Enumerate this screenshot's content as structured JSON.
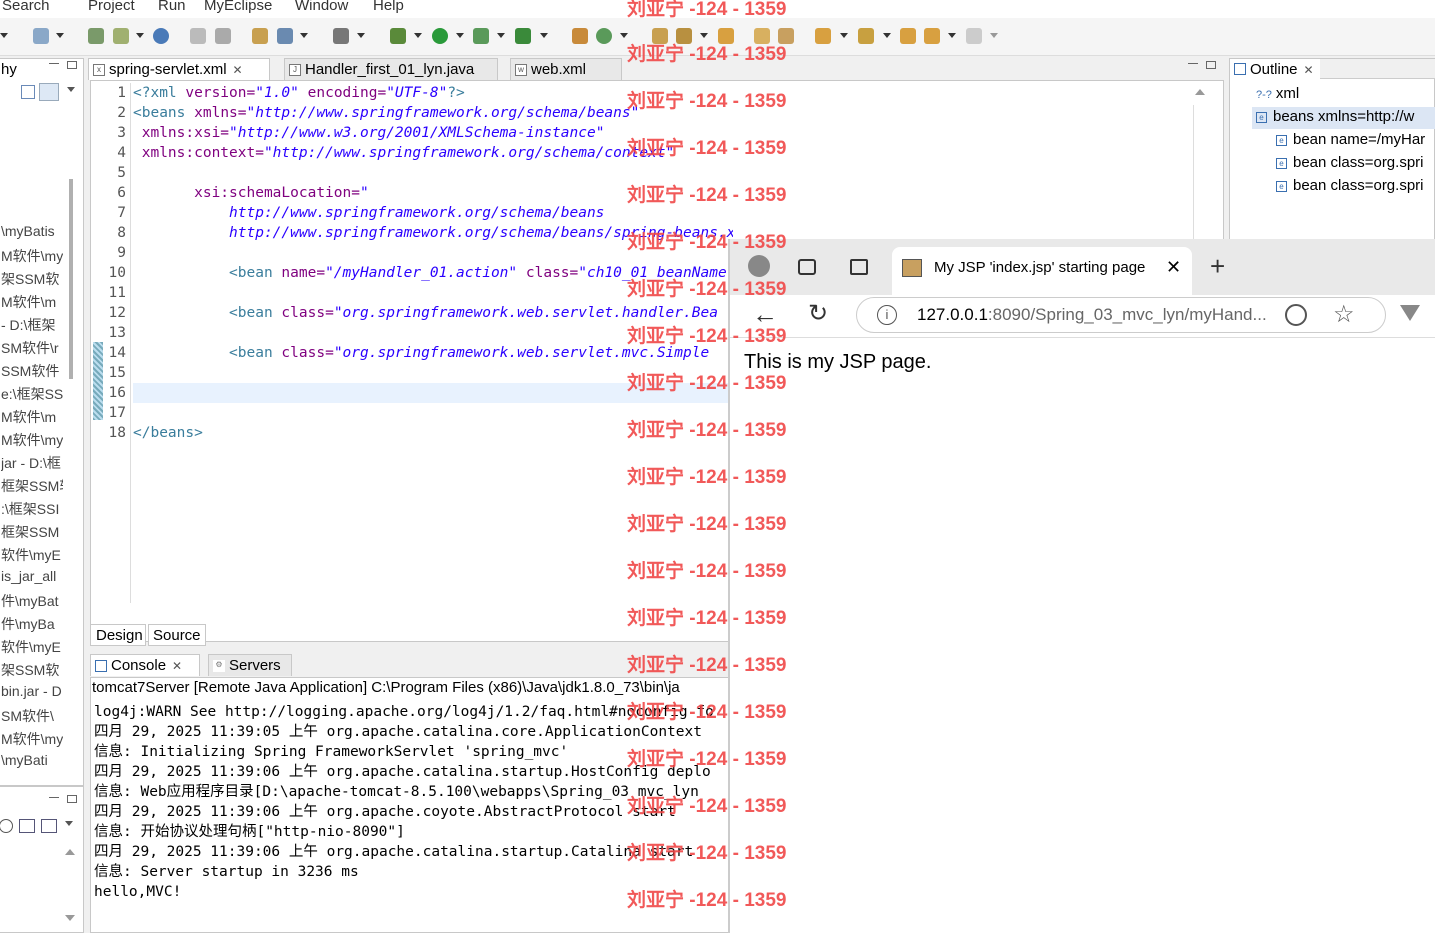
{
  "menu": [
    "Search",
    "Project",
    "Run",
    "MyEclipse",
    "Window",
    "Help"
  ],
  "left_panel": {
    "tab_label": "hy",
    "items": [
      "\\myBatis",
      "M软件\\my",
      "架SSM软",
      "M软件\\m",
      " - D:\\框架",
      "SM软件\\r",
      "SSM软件",
      "e:\\框架SS",
      "M软件\\m",
      "M软件\\my",
      "jar - D:\\框",
      "框架SSM软",
      ":\\框架SSI",
      "框架SSM",
      "软件\\myE",
      "is_jar_all",
      "件\\myBat",
      "件\\myBa",
      "软件\\myE",
      "架SSM软",
      "bin.jar - D",
      "SM软件\\",
      "M软件\\my",
      "\\myBati"
    ]
  },
  "editor": {
    "tabs": [
      {
        "label": "spring-servlet.xml",
        "icon": "xml-file-icon",
        "active": true
      },
      {
        "label": "Handler_first_01_lyn.java",
        "icon": "java-file-icon",
        "active": false
      },
      {
        "label": "web.xml",
        "icon": "web-xml-icon",
        "active": false
      }
    ],
    "line_numbers": [
      "1",
      "2",
      "3",
      "4",
      "5",
      "6",
      "7",
      "8",
      "9",
      "10",
      "11",
      "12",
      "13",
      "14",
      "15",
      "16",
      "17",
      "18"
    ],
    "bottom_tabs": [
      "Design",
      "Source"
    ]
  },
  "outline": {
    "tab_label": "Outline",
    "items": [
      "xml",
      "beans xmlns=http://w",
      "bean name=/myHar",
      "bean class=org.spri",
      "bean class=org.spri"
    ]
  },
  "console": {
    "tabs": [
      "Console",
      "Servers"
    ],
    "header": "tomcat7Server [Remote Java Application] C:\\Program Files (x86)\\Java\\jdk1.8.0_73\\bin\\ja",
    "lines": [
      "log4j:WARN See http://logging.apache.org/log4j/1.2/faq.html#noconfig fo",
      "四月 29, 2025 11:39:05 上午 org.apache.catalina.core.ApplicationContext",
      "信息: Initializing Spring FrameworkServlet 'spring_mvc'",
      "四月 29, 2025 11:39:06 上午 org.apache.catalina.startup.HostConfig deplo",
      "信息: Web应用程序目录[D:\\apache-tomcat-8.5.100\\webapps\\Spring_03_mvc_lyn",
      "四月 29, 2025 11:39:06 上午 org.apache.coyote.AbstractProtocol start",
      "信息: 开始协议处理句柄[\"http-nio-8090\"]",
      "四月 29, 2025 11:39:06 上午 org.apache.catalina.startup.Catalina start",
      "信息: Server startup in 3236 ms",
      "hello,MVC!"
    ]
  },
  "browser": {
    "tab_title": "My JSP 'index.jsp' starting page",
    "url_host": "127.0.0.1",
    "url_rest": ":8090/Spring_03_mvc_lyn/myHand...",
    "page_text": "This is my JSP page."
  },
  "watermark": "刘亚宁 -124 - 1359"
}
